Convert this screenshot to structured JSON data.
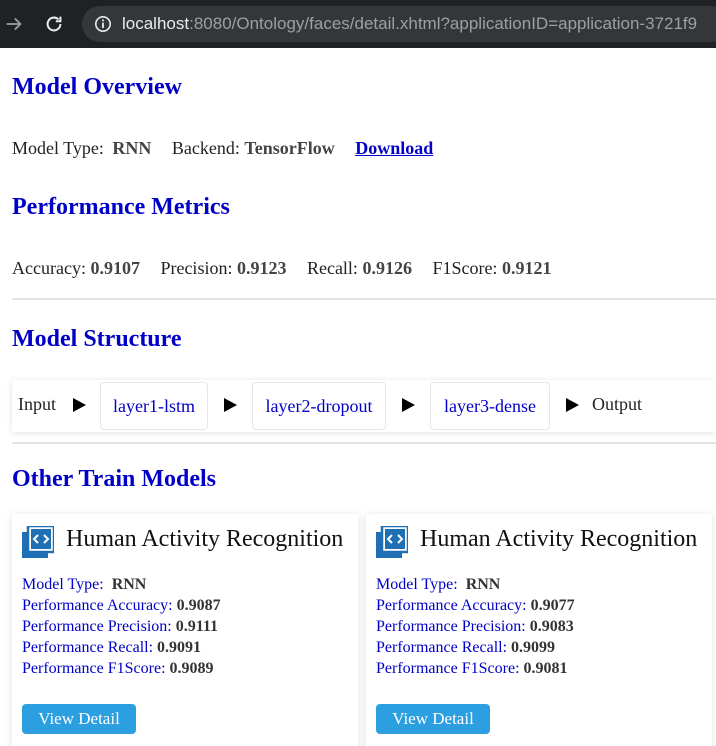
{
  "browser": {
    "url_host": "localhost",
    "url_path": ":8080/Ontology/faces/detail.xhtml?applicationID=application-3721f9"
  },
  "overview": {
    "heading": "Model Overview",
    "model_type_label": "Model Type:",
    "model_type_value": "RNN",
    "backend_label": "Backend:",
    "backend_value": "TensorFlow",
    "download_label": "Download"
  },
  "metrics": {
    "heading": "Performance Metrics",
    "accuracy_label": "Accuracy:",
    "accuracy_value": "0.9107",
    "precision_label": "Precision:",
    "precision_value": "0.9123",
    "recall_label": "Recall:",
    "recall_value": "0.9126",
    "f1_label": "F1Score:",
    "f1_value": "0.9121"
  },
  "structure": {
    "heading": "Model Structure",
    "input_label": "Input",
    "output_label": "Output",
    "layers": [
      "layer1-lstm",
      "layer2-dropout",
      "layer3-dense"
    ]
  },
  "others": {
    "heading": "Other Train Models",
    "cards": [
      {
        "title": "Human Activity Recognition",
        "model_type_label": "Model Type:",
        "model_type_value": "RNN",
        "accuracy_label": "Performance Accuracy:",
        "accuracy_value": "0.9087",
        "precision_label": "Performance Precision:",
        "precision_value": "0.9111",
        "recall_label": "Performance Recall:",
        "recall_value": "0.9091",
        "f1_label": "Performance F1Score:",
        "f1_value": "0.9089",
        "button_label": "View Detail"
      },
      {
        "title": "Human Activity Recognition",
        "model_type_label": "Model Type:",
        "model_type_value": "RNN",
        "accuracy_label": "Performance Accuracy:",
        "accuracy_value": "0.9077",
        "precision_label": "Performance Precision:",
        "precision_value": "0.9083",
        "recall_label": "Performance Recall:",
        "recall_value": "0.9099",
        "f1_label": "Performance F1Score:",
        "f1_value": "0.9081",
        "button_label": "View Detail"
      }
    ]
  },
  "colors": {
    "heading": "#0000c8",
    "button": "#2b9fe0",
    "browser_bar": "#202124"
  },
  "icons": [
    "forward-arrow-icon",
    "reload-icon",
    "info-icon",
    "arrow-right-icon",
    "code-icon"
  ]
}
